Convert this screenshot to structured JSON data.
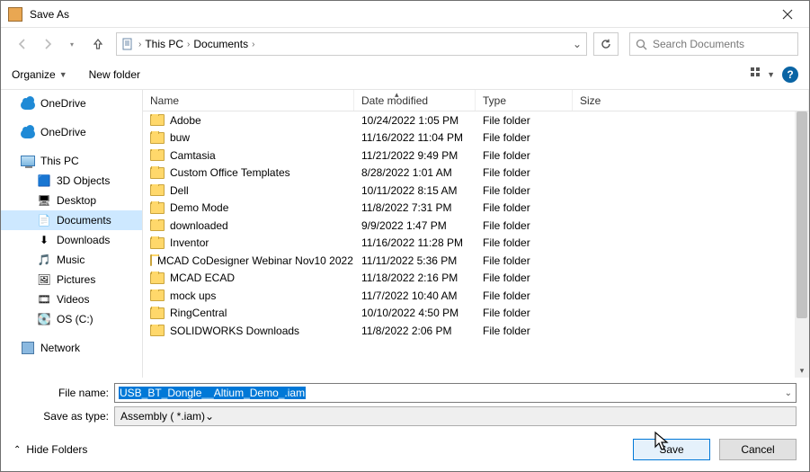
{
  "title": "Save As",
  "breadcrumb": {
    "root": "This PC",
    "folder": "Documents"
  },
  "search_placeholder": "Search Documents",
  "toolbar": {
    "organize": "Organize",
    "newfolder": "New folder"
  },
  "sidebar": {
    "onedrive1": "OneDrive",
    "onedrive2": "OneDrive",
    "thispc": "This PC",
    "items": [
      "3D Objects",
      "Desktop",
      "Documents",
      "Downloads",
      "Music",
      "Pictures",
      "Videos",
      "OS (C:)"
    ],
    "network": "Network"
  },
  "columns": {
    "name": "Name",
    "date": "Date modified",
    "type": "Type",
    "size": "Size"
  },
  "rows": [
    {
      "name": "Adobe",
      "date": "10/24/2022 1:05 PM",
      "type": "File folder"
    },
    {
      "name": "buw",
      "date": "11/16/2022 11:04 PM",
      "type": "File folder"
    },
    {
      "name": "Camtasia",
      "date": "11/21/2022 9:49 PM",
      "type": "File folder"
    },
    {
      "name": "Custom Office Templates",
      "date": "8/28/2022 1:01 AM",
      "type": "File folder"
    },
    {
      "name": "Dell",
      "date": "10/11/2022 8:15 AM",
      "type": "File folder"
    },
    {
      "name": "Demo Mode",
      "date": "11/8/2022 7:31 PM",
      "type": "File folder"
    },
    {
      "name": "downloaded",
      "date": "9/9/2022 1:47 PM",
      "type": "File folder"
    },
    {
      "name": "Inventor",
      "date": "11/16/2022 11:28 PM",
      "type": "File folder"
    },
    {
      "name": "MCAD CoDesigner Webinar Nov10 2022 ...",
      "date": "11/11/2022 5:36 PM",
      "type": "File folder"
    },
    {
      "name": "MCAD ECAD",
      "date": "11/18/2022 2:16 PM",
      "type": "File folder"
    },
    {
      "name": "mock ups",
      "date": "11/7/2022 10:40 AM",
      "type": "File folder"
    },
    {
      "name": "RingCentral",
      "date": "10/10/2022 4:50 PM",
      "type": "File folder"
    },
    {
      "name": "SOLIDWORKS Downloads",
      "date": "11/8/2022 2:06 PM",
      "type": "File folder"
    }
  ],
  "fields": {
    "fname_label": "File name:",
    "fname_value": "USB_BT_Dongle__Altium_Demo_.iam",
    "ftype_label": "Save as type:",
    "ftype_value": "Assembly  ( *.iam)"
  },
  "footer": {
    "hide": "Hide Folders",
    "save": "Save",
    "cancel": "Cancel"
  }
}
